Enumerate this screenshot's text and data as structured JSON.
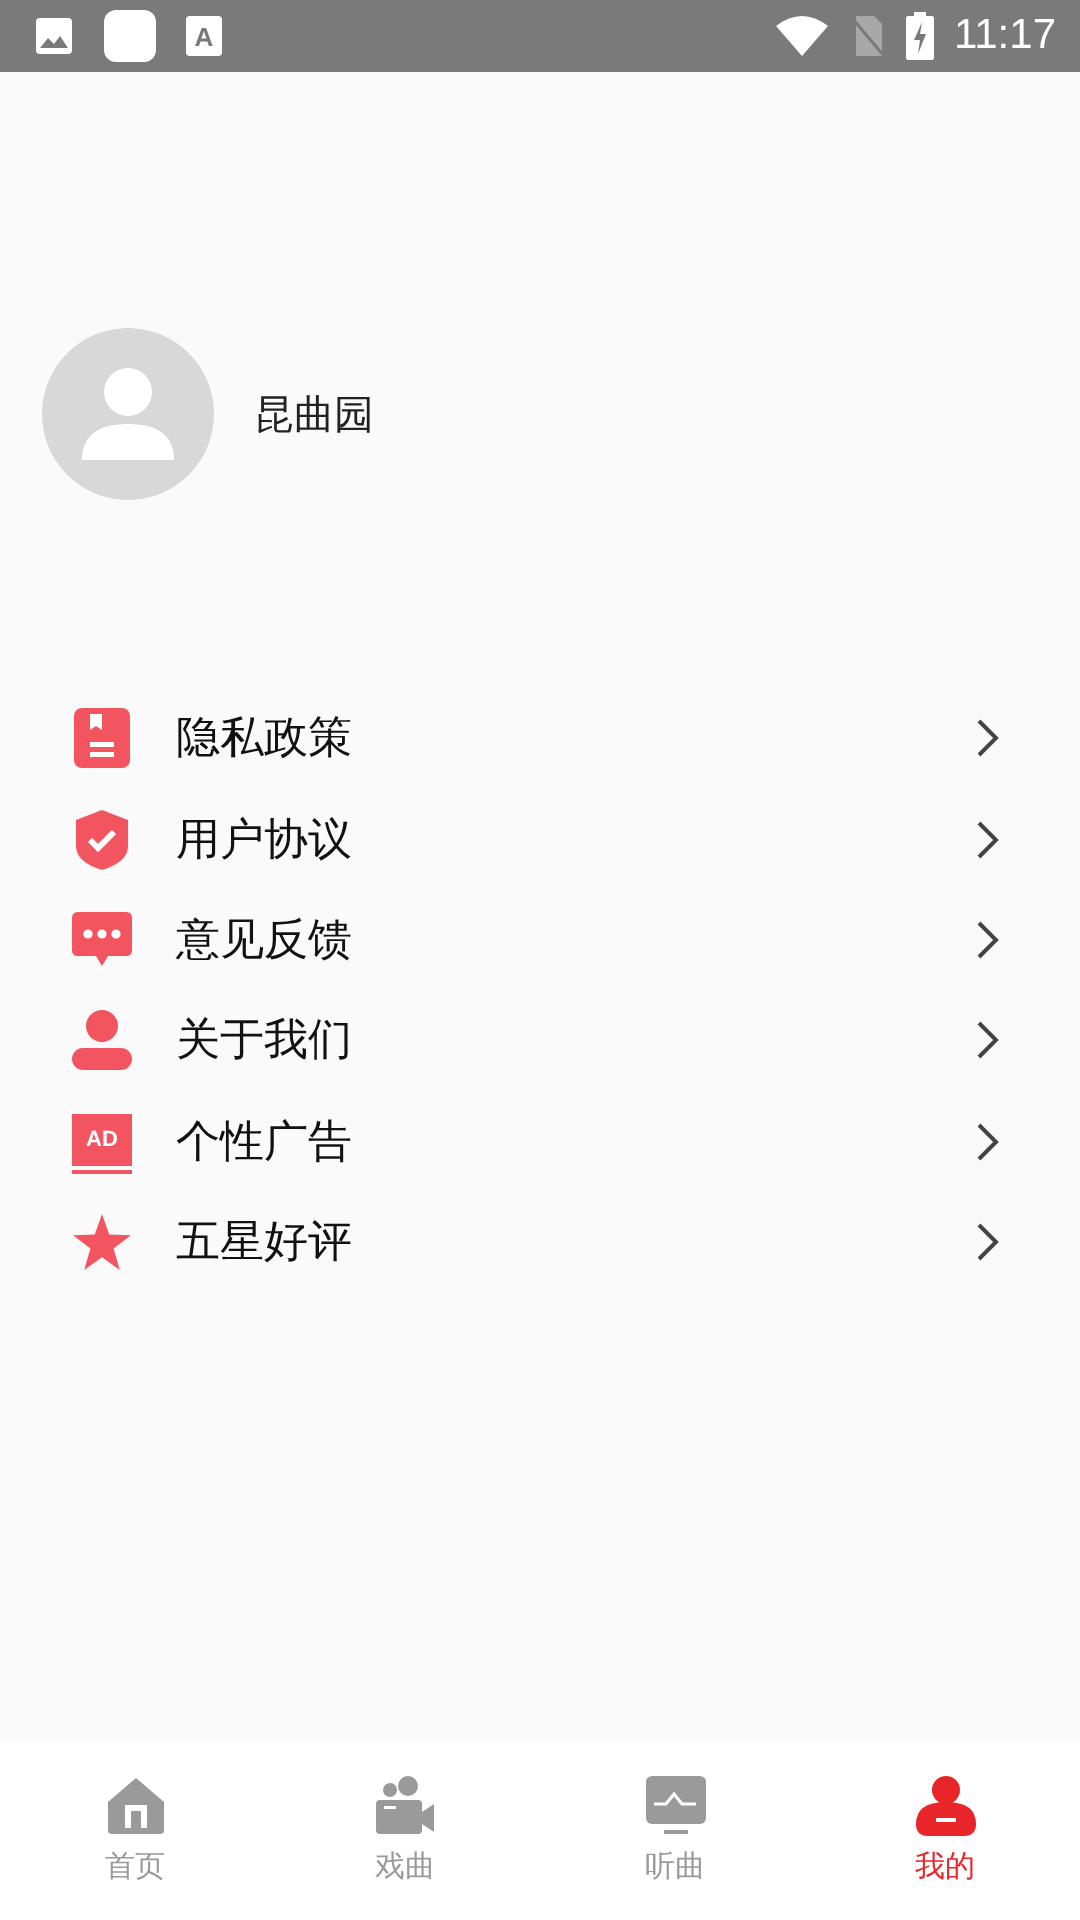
{
  "status_bar": {
    "time": "11:17",
    "notifications": [
      {
        "kind": "image"
      },
      {
        "kind": "blank"
      },
      {
        "kind": "font",
        "text": "A"
      }
    ]
  },
  "profile": {
    "name": "昆曲园"
  },
  "menu": [
    {
      "label": "隐私政策",
      "kind": "document"
    },
    {
      "label": "用户协议",
      "kind": "shield"
    },
    {
      "label": "意见反馈",
      "kind": "chat"
    },
    {
      "label": "关于我们",
      "kind": "person"
    },
    {
      "label": "个性广告",
      "kind": "ad",
      "icon_text": "AD"
    },
    {
      "label": "五星好评",
      "kind": "star"
    }
  ],
  "tabs": [
    {
      "label": "首页",
      "kind": "home",
      "selected": false
    },
    {
      "label": "戏曲",
      "kind": "camera",
      "selected": false
    },
    {
      "label": "听曲",
      "kind": "monitor",
      "selected": false
    },
    {
      "label": "我的",
      "kind": "person",
      "selected": true
    }
  ]
}
